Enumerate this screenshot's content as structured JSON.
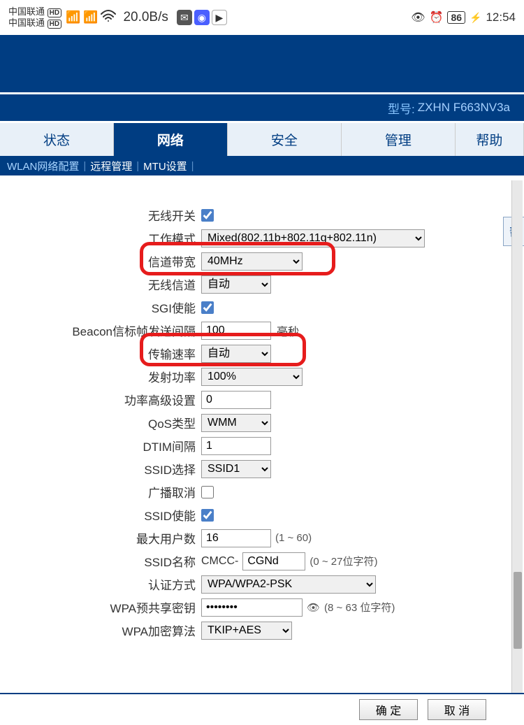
{
  "status_bar": {
    "carrier": "中国联通",
    "hd": "HD",
    "signal_g": "5G",
    "speed": "20.0B/s",
    "battery": "86",
    "time": "12:54"
  },
  "model": {
    "label": "型号:",
    "value": "ZXHN F663NV3a"
  },
  "nav": {
    "tabs": [
      "状态",
      "网络",
      "安全",
      "管理",
      "帮助"
    ],
    "active": 1,
    "sub": {
      "wlan": "WLAN网络配置",
      "remote": "远程管理",
      "mtu": "MTU设置"
    }
  },
  "form": {
    "wireless_switch": {
      "label": "无线开关",
      "checked": true
    },
    "work_mode": {
      "label": "工作模式",
      "value": "Mixed(802.11b+802.11g+802.11n)"
    },
    "bandwidth": {
      "label": "信道带宽",
      "value": "40MHz"
    },
    "channel": {
      "label": "无线信道",
      "value": "自动"
    },
    "sgi": {
      "label": "SGI使能",
      "checked": true
    },
    "beacon": {
      "label": "Beacon信标帧发送间隔",
      "value": "100",
      "unit": "毫秒"
    },
    "tx_rate": {
      "label": "传输速率",
      "value": "自动"
    },
    "tx_power": {
      "label": "发射功率",
      "value": "100%"
    },
    "adv_power": {
      "label": "功率高级设置",
      "value": "0"
    },
    "qos": {
      "label": "QoS类型",
      "value": "WMM"
    },
    "dtim": {
      "label": "DTIM间隔",
      "value": "1"
    },
    "ssid_select": {
      "label": "SSID选择",
      "value": "SSID1"
    },
    "broadcast": {
      "label": "广播取消",
      "checked": false
    },
    "ssid_enable": {
      "label": "SSID使能",
      "checked": true
    },
    "max_users": {
      "label": "最大用户数",
      "value": "16",
      "hint": "(1 ~ 60)"
    },
    "ssid_name": {
      "label": "SSID名称",
      "prefix": "CMCC-",
      "value": "CGNd",
      "hint": "(0 ~ 27位字符)"
    },
    "auth": {
      "label": "认证方式",
      "value": "WPA/WPA2-PSK"
    },
    "wpa_key": {
      "label": "WPA预共享密钥",
      "value": "••••••••",
      "hint": "(8 ~ 63 位字符)"
    },
    "wpa_algo": {
      "label": "WPA加密算法",
      "value": "TKIP+AES"
    }
  },
  "side_tab": "帮",
  "footer": {
    "ok": "确 定",
    "cancel": "取 消"
  }
}
